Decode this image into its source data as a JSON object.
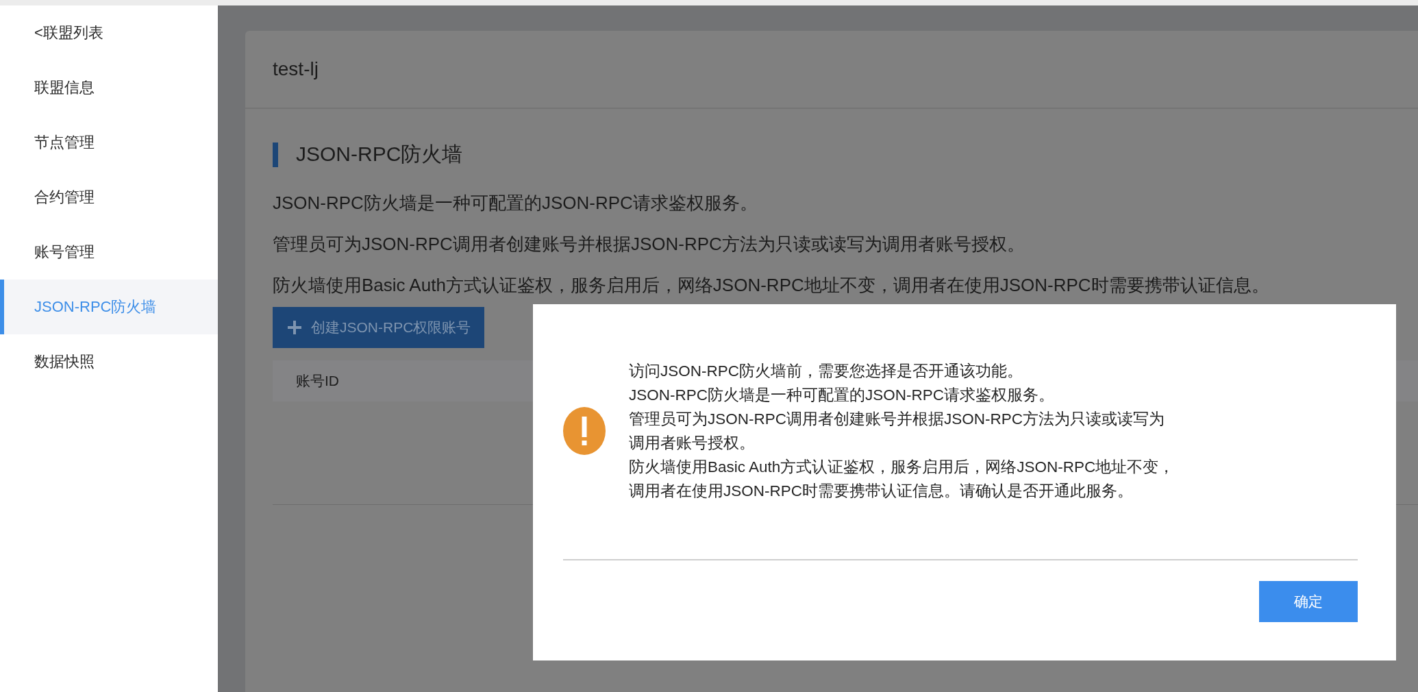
{
  "sidebar": {
    "back_link": "<联盟列表",
    "items": [
      {
        "label": "联盟信息",
        "selected": false
      },
      {
        "label": "节点管理",
        "selected": false
      },
      {
        "label": "合约管理",
        "selected": false
      },
      {
        "label": "账号管理",
        "selected": false
      },
      {
        "label": "JSON-RPC防火墙",
        "selected": true
      },
      {
        "label": "数据快照",
        "selected": false
      }
    ]
  },
  "card": {
    "title": "test-lj",
    "section_title": "JSON-RPC防火墙",
    "description": [
      "JSON-RPC防火墙是一种可配置的JSON-RPC请求鉴权服务。",
      "管理员可为JSON-RPC调用者创建账号并根据JSON-RPC方法为只读或读写为调用者账号授权。",
      "防火墙使用Basic Auth方式认证鉴权，服务启用后，网络JSON-RPC地址不变，调用者在使用JSON-RPC时需要携带认证信息。"
    ],
    "create_button": "创建JSON-RPC权限账号",
    "table": {
      "columns": [
        "账号ID"
      ]
    }
  },
  "dialog": {
    "paragraphs": [
      "访问JSON-RPC防火墙前，需要您选择是否开通该功能。",
      "JSON-RPC防火墙是一种可配置的JSON-RPC请求鉴权服务。",
      "管理员可为JSON-RPC调用者创建账号并根据JSON-RPC方法为只读或读写为调用者账号授权。",
      "防火墙使用Basic Auth方式认证鉴权，服务启用后，网络JSON-RPC地址不变，调用者在使用JSON-RPC时需要携带认证信息。请确认是否开通此服务。"
    ],
    "confirm_button": "确定"
  }
}
